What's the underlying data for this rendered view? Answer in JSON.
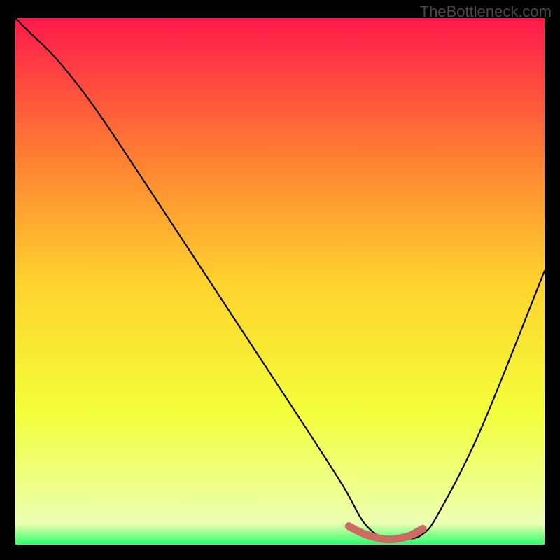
{
  "watermark": "TheBottleneck.com",
  "chart_data": {
    "type": "line",
    "title": "",
    "xlabel": "",
    "ylabel": "",
    "xlim": [
      0,
      100
    ],
    "ylim": [
      0,
      100
    ],
    "gradient_stops": [
      {
        "offset": 0,
        "color": "#ff1a4b"
      },
      {
        "offset": 25,
        "color": "#ff7a33"
      },
      {
        "offset": 50,
        "color": "#ffd22e"
      },
      {
        "offset": 75,
        "color": "#f3ff3a"
      },
      {
        "offset": 96,
        "color": "#ecffb2"
      },
      {
        "offset": 100,
        "color": "#2eff6a"
      }
    ],
    "series": [
      {
        "name": "bottleneck-curve",
        "x": [
          0,
          3,
          8,
          15,
          25,
          40,
          55,
          62,
          66,
          70,
          74,
          77,
          80,
          88,
          100
        ],
        "y": [
          100,
          97,
          92,
          83,
          68,
          45,
          22,
          11,
          4,
          1,
          1,
          2,
          6,
          22,
          52
        ]
      }
    ],
    "highlight": {
      "name": "optimal-range",
      "color": "#cc6b63",
      "x": [
        63,
        66,
        70,
        74,
        77
      ],
      "y": [
        3.5,
        2,
        1,
        1.5,
        3
      ]
    }
  }
}
